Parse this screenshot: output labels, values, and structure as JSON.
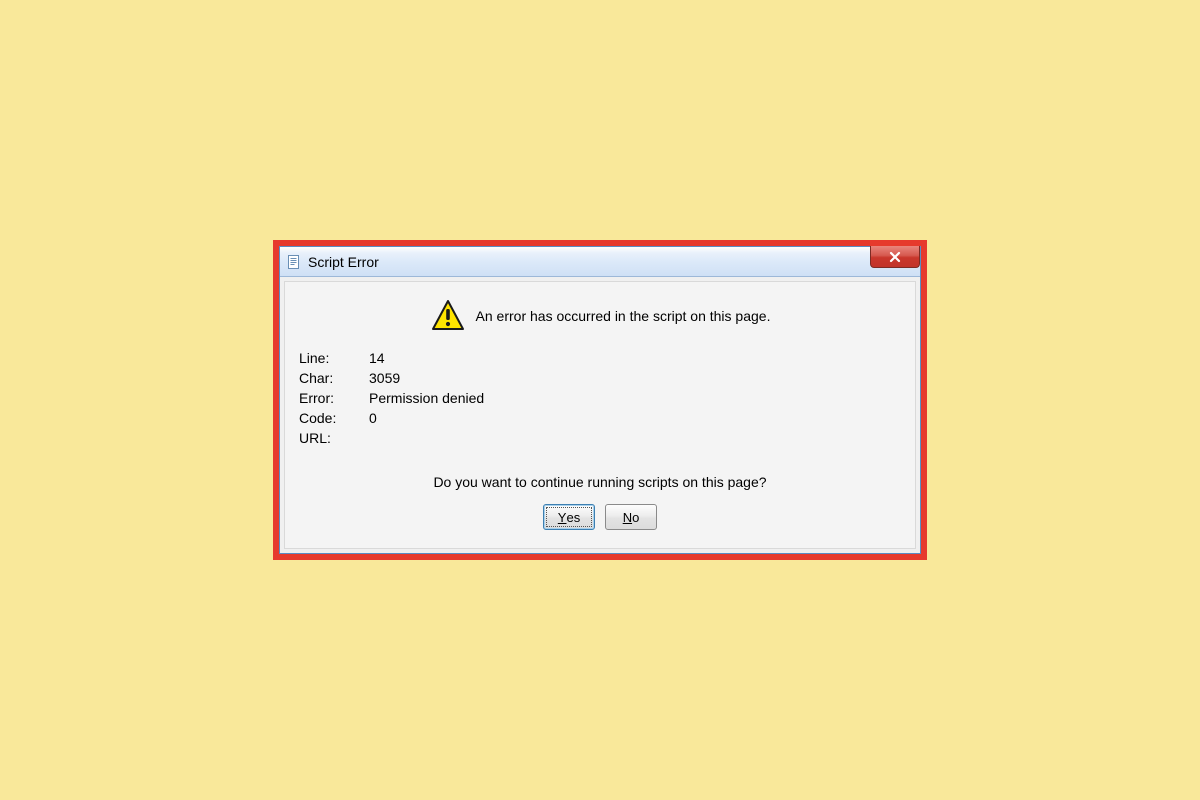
{
  "dialog": {
    "title": "Script Error",
    "message": "An error has occurred in the script on this page.",
    "details": {
      "line_label": "Line:",
      "line_value": "14",
      "char_label": "Char:",
      "char_value": "3059",
      "error_label": "Error:",
      "error_value": "Permission denied",
      "code_label": "Code:",
      "code_value": "0",
      "url_label": "URL:",
      "url_value": ""
    },
    "prompt": "Do you want to continue running scripts on this page?",
    "buttons": {
      "yes": "Yes",
      "no": "No"
    }
  }
}
